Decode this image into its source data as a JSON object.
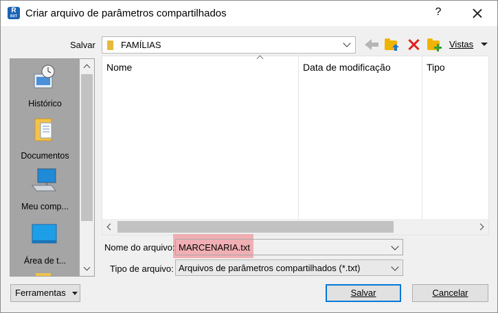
{
  "window": {
    "app_icon_letter": "R",
    "app_icon_sub": "RXT",
    "title": "Criar arquivo de parâmetros compartilhados",
    "help_label": "?"
  },
  "location": {
    "label": "Salvar",
    "current_folder": "FAMÍLIAS"
  },
  "toolbar": {
    "views_label": "Vistas"
  },
  "places": [
    {
      "label": "Histórico",
      "icon": "history-icon"
    },
    {
      "label": "Documentos",
      "icon": "documents-icon"
    },
    {
      "label": "Meu comp...",
      "icon": "computer-icon"
    },
    {
      "label": "Área de t...",
      "icon": "desktop-icon"
    }
  ],
  "file_list": {
    "columns": [
      "Nome",
      "Data de modificação",
      "Tipo"
    ],
    "rows": []
  },
  "form": {
    "filename_label": "Nome do arquivo:",
    "filename_value": "MARCENARIA.txt",
    "filetype_label": "Tipo de arquivo:",
    "filetype_value": "Arquivos de parâmetros compartilhados (*.txt)"
  },
  "buttons": {
    "tools": "Ferramentas",
    "save": "Salvar",
    "cancel": "Cancelar"
  },
  "colors": {
    "highlight": "#f06e78",
    "places_bg": "#a5a5a5",
    "app_icon": "#1b64b5",
    "delete_red": "#e0201c",
    "folder_yellow": "#f0b400"
  }
}
